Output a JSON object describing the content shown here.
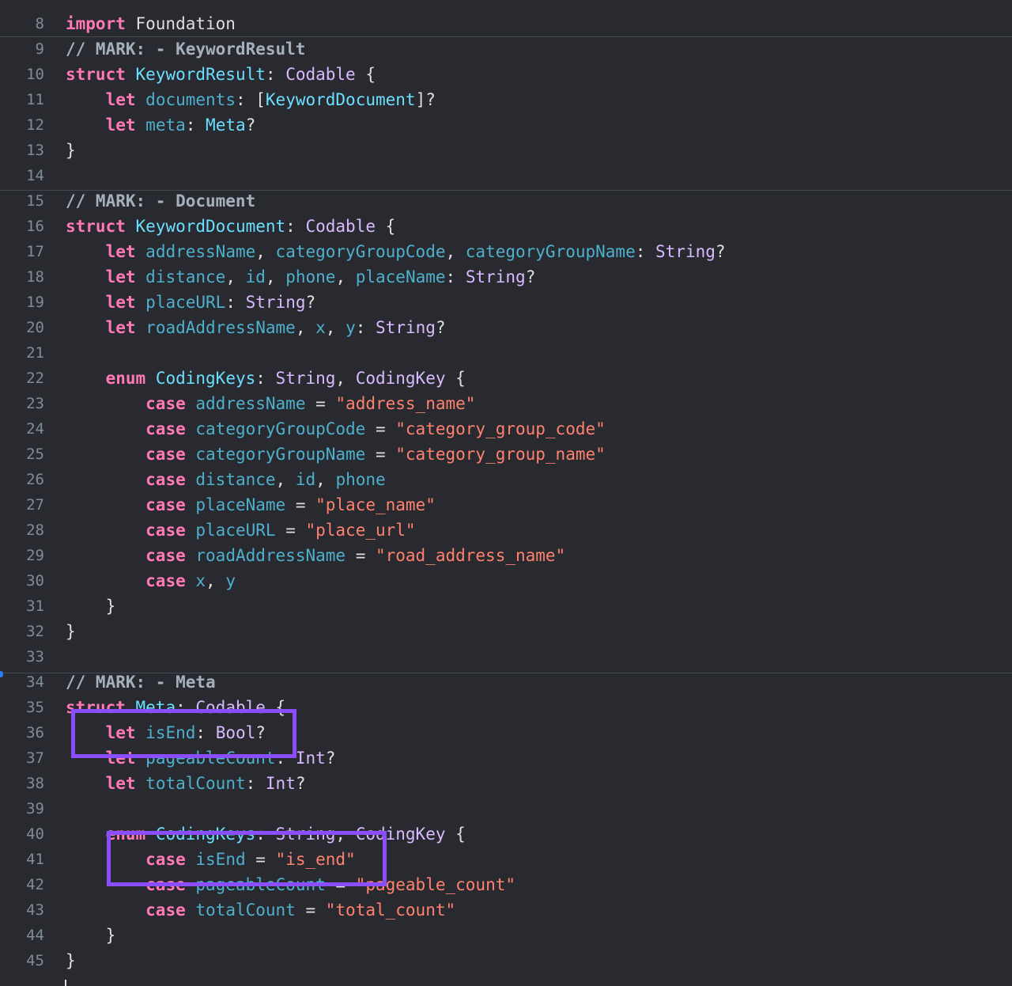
{
  "editor": {
    "language": "swift",
    "theme": "dark",
    "colors": {
      "background": "#292a30",
      "keyword": "#ff7ab2",
      "type": "#dabaff",
      "type_decl": "#6bdfff",
      "property": "#4eb0cc",
      "string": "#ff8170",
      "comment": "#a4b0bc",
      "plain": "#dfdfe0",
      "line_number": "#7f8c98",
      "highlight_box": "#8a4dff"
    },
    "lines": [
      {
        "num": "8",
        "tokens": [
          {
            "t": "import",
            "k": "kw"
          },
          {
            "t": " Foundation",
            "k": "pl"
          }
        ]
      },
      {
        "num": "9",
        "tokens": [
          {
            "t": "// MARK: - KeywordResult",
            "k": "cm"
          }
        ]
      },
      {
        "num": "10",
        "tokens": [
          {
            "t": "struct",
            "k": "kw"
          },
          {
            "t": " ",
            "k": "pl"
          },
          {
            "t": "KeywordResult",
            "k": "td"
          },
          {
            "t": ": ",
            "k": "pl"
          },
          {
            "t": "Codable",
            "k": "ty"
          },
          {
            "t": " {",
            "k": "pl"
          }
        ]
      },
      {
        "num": "11",
        "tokens": [
          {
            "t": "    ",
            "k": "pl"
          },
          {
            "t": "let",
            "k": "kw"
          },
          {
            "t": " ",
            "k": "pl"
          },
          {
            "t": "documents",
            "k": "pd"
          },
          {
            "t": ": [",
            "k": "pl"
          },
          {
            "t": "KeywordDocument",
            "k": "td"
          },
          {
            "t": "]?",
            "k": "pl"
          }
        ]
      },
      {
        "num": "12",
        "tokens": [
          {
            "t": "    ",
            "k": "pl"
          },
          {
            "t": "let",
            "k": "kw"
          },
          {
            "t": " ",
            "k": "pl"
          },
          {
            "t": "meta",
            "k": "pd"
          },
          {
            "t": ": ",
            "k": "pl"
          },
          {
            "t": "Meta",
            "k": "td"
          },
          {
            "t": "?",
            "k": "pl"
          }
        ]
      },
      {
        "num": "13",
        "tokens": [
          {
            "t": "}",
            "k": "pl"
          }
        ]
      },
      {
        "num": "14",
        "tokens": []
      },
      {
        "num": "15",
        "tokens": [
          {
            "t": "// MARK: - Document",
            "k": "cm"
          }
        ]
      },
      {
        "num": "16",
        "tokens": [
          {
            "t": "struct",
            "k": "kw"
          },
          {
            "t": " ",
            "k": "pl"
          },
          {
            "t": "KeywordDocument",
            "k": "td"
          },
          {
            "t": ": ",
            "k": "pl"
          },
          {
            "t": "Codable",
            "k": "ty"
          },
          {
            "t": " {",
            "k": "pl"
          }
        ]
      },
      {
        "num": "17",
        "tokens": [
          {
            "t": "    ",
            "k": "pl"
          },
          {
            "t": "let",
            "k": "kw"
          },
          {
            "t": " ",
            "k": "pl"
          },
          {
            "t": "addressName",
            "k": "pd"
          },
          {
            "t": ", ",
            "k": "pl"
          },
          {
            "t": "categoryGroupCode",
            "k": "pd"
          },
          {
            "t": ", ",
            "k": "pl"
          },
          {
            "t": "categoryGroupName",
            "k": "pd"
          },
          {
            "t": ": ",
            "k": "pl"
          },
          {
            "t": "String",
            "k": "ty"
          },
          {
            "t": "?",
            "k": "pl"
          }
        ]
      },
      {
        "num": "18",
        "tokens": [
          {
            "t": "    ",
            "k": "pl"
          },
          {
            "t": "let",
            "k": "kw"
          },
          {
            "t": " ",
            "k": "pl"
          },
          {
            "t": "distance",
            "k": "pd"
          },
          {
            "t": ", ",
            "k": "pl"
          },
          {
            "t": "id",
            "k": "pd"
          },
          {
            "t": ", ",
            "k": "pl"
          },
          {
            "t": "phone",
            "k": "pd"
          },
          {
            "t": ", ",
            "k": "pl"
          },
          {
            "t": "placeName",
            "k": "pd"
          },
          {
            "t": ": ",
            "k": "pl"
          },
          {
            "t": "String",
            "k": "ty"
          },
          {
            "t": "?",
            "k": "pl"
          }
        ]
      },
      {
        "num": "19",
        "tokens": [
          {
            "t": "    ",
            "k": "pl"
          },
          {
            "t": "let",
            "k": "kw"
          },
          {
            "t": " ",
            "k": "pl"
          },
          {
            "t": "placeURL",
            "k": "pd"
          },
          {
            "t": ": ",
            "k": "pl"
          },
          {
            "t": "String",
            "k": "ty"
          },
          {
            "t": "?",
            "k": "pl"
          }
        ]
      },
      {
        "num": "20",
        "tokens": [
          {
            "t": "    ",
            "k": "pl"
          },
          {
            "t": "let",
            "k": "kw"
          },
          {
            "t": " ",
            "k": "pl"
          },
          {
            "t": "roadAddressName",
            "k": "pd"
          },
          {
            "t": ", ",
            "k": "pl"
          },
          {
            "t": "x",
            "k": "pd"
          },
          {
            "t": ", ",
            "k": "pl"
          },
          {
            "t": "y",
            "k": "pd"
          },
          {
            "t": ": ",
            "k": "pl"
          },
          {
            "t": "String",
            "k": "ty"
          },
          {
            "t": "?",
            "k": "pl"
          }
        ]
      },
      {
        "num": "21",
        "tokens": []
      },
      {
        "num": "22",
        "tokens": [
          {
            "t": "    ",
            "k": "pl"
          },
          {
            "t": "enum",
            "k": "kw"
          },
          {
            "t": " ",
            "k": "pl"
          },
          {
            "t": "CodingKeys",
            "k": "td"
          },
          {
            "t": ": ",
            "k": "pl"
          },
          {
            "t": "String",
            "k": "ty"
          },
          {
            "t": ", ",
            "k": "pl"
          },
          {
            "t": "CodingKey",
            "k": "ty"
          },
          {
            "t": " {",
            "k": "pl"
          }
        ]
      },
      {
        "num": "23",
        "tokens": [
          {
            "t": "        ",
            "k": "pl"
          },
          {
            "t": "case",
            "k": "kw"
          },
          {
            "t": " ",
            "k": "pl"
          },
          {
            "t": "addressName",
            "k": "pd"
          },
          {
            "t": " = ",
            "k": "pl"
          },
          {
            "t": "\"address_name\"",
            "k": "str"
          }
        ]
      },
      {
        "num": "24",
        "tokens": [
          {
            "t": "        ",
            "k": "pl"
          },
          {
            "t": "case",
            "k": "kw"
          },
          {
            "t": " ",
            "k": "pl"
          },
          {
            "t": "categoryGroupCode",
            "k": "pd"
          },
          {
            "t": " = ",
            "k": "pl"
          },
          {
            "t": "\"category_group_code\"",
            "k": "str"
          }
        ]
      },
      {
        "num": "25",
        "tokens": [
          {
            "t": "        ",
            "k": "pl"
          },
          {
            "t": "case",
            "k": "kw"
          },
          {
            "t": " ",
            "k": "pl"
          },
          {
            "t": "categoryGroupName",
            "k": "pd"
          },
          {
            "t": " = ",
            "k": "pl"
          },
          {
            "t": "\"category_group_name\"",
            "k": "str"
          }
        ]
      },
      {
        "num": "26",
        "tokens": [
          {
            "t": "        ",
            "k": "pl"
          },
          {
            "t": "case",
            "k": "kw"
          },
          {
            "t": " ",
            "k": "pl"
          },
          {
            "t": "distance",
            "k": "pd"
          },
          {
            "t": ", ",
            "k": "pl"
          },
          {
            "t": "id",
            "k": "pd"
          },
          {
            "t": ", ",
            "k": "pl"
          },
          {
            "t": "phone",
            "k": "pd"
          }
        ]
      },
      {
        "num": "27",
        "tokens": [
          {
            "t": "        ",
            "k": "pl"
          },
          {
            "t": "case",
            "k": "kw"
          },
          {
            "t": " ",
            "k": "pl"
          },
          {
            "t": "placeName",
            "k": "pd"
          },
          {
            "t": " = ",
            "k": "pl"
          },
          {
            "t": "\"place_name\"",
            "k": "str"
          }
        ]
      },
      {
        "num": "28",
        "tokens": [
          {
            "t": "        ",
            "k": "pl"
          },
          {
            "t": "case",
            "k": "kw"
          },
          {
            "t": " ",
            "k": "pl"
          },
          {
            "t": "placeURL",
            "k": "pd"
          },
          {
            "t": " = ",
            "k": "pl"
          },
          {
            "t": "\"place_url\"",
            "k": "str"
          }
        ]
      },
      {
        "num": "29",
        "tokens": [
          {
            "t": "        ",
            "k": "pl"
          },
          {
            "t": "case",
            "k": "kw"
          },
          {
            "t": " ",
            "k": "pl"
          },
          {
            "t": "roadAddressName",
            "k": "pd"
          },
          {
            "t": " = ",
            "k": "pl"
          },
          {
            "t": "\"road_address_name\"",
            "k": "str"
          }
        ]
      },
      {
        "num": "30",
        "tokens": [
          {
            "t": "        ",
            "k": "pl"
          },
          {
            "t": "case",
            "k": "kw"
          },
          {
            "t": " ",
            "k": "pl"
          },
          {
            "t": "x",
            "k": "pd"
          },
          {
            "t": ", ",
            "k": "pl"
          },
          {
            "t": "y",
            "k": "pd"
          }
        ]
      },
      {
        "num": "31",
        "tokens": [
          {
            "t": "    }",
            "k": "pl"
          }
        ]
      },
      {
        "num": "32",
        "tokens": [
          {
            "t": "}",
            "k": "pl"
          }
        ]
      },
      {
        "num": "33",
        "tokens": []
      },
      {
        "num": "34",
        "tokens": [
          {
            "t": "// MARK: - Meta",
            "k": "cm"
          }
        ]
      },
      {
        "num": "35",
        "tokens": [
          {
            "t": "struct",
            "k": "kw"
          },
          {
            "t": " ",
            "k": "pl"
          },
          {
            "t": "Meta",
            "k": "td"
          },
          {
            "t": ": ",
            "k": "pl"
          },
          {
            "t": "Codable",
            "k": "ty"
          },
          {
            "t": " {",
            "k": "pl"
          }
        ]
      },
      {
        "num": "36",
        "tokens": [
          {
            "t": "    ",
            "k": "pl"
          },
          {
            "t": "let",
            "k": "kw"
          },
          {
            "t": " ",
            "k": "pl"
          },
          {
            "t": "isEnd",
            "k": "pd"
          },
          {
            "t": ": ",
            "k": "pl"
          },
          {
            "t": "Bool",
            "k": "ty"
          },
          {
            "t": "?",
            "k": "pl"
          }
        ]
      },
      {
        "num": "37",
        "tokens": [
          {
            "t": "    ",
            "k": "pl"
          },
          {
            "t": "let",
            "k": "kw"
          },
          {
            "t": " ",
            "k": "pl"
          },
          {
            "t": "pageableCount",
            "k": "pd"
          },
          {
            "t": ": ",
            "k": "pl"
          },
          {
            "t": "Int",
            "k": "ty"
          },
          {
            "t": "?",
            "k": "pl"
          }
        ]
      },
      {
        "num": "38",
        "tokens": [
          {
            "t": "    ",
            "k": "pl"
          },
          {
            "t": "let",
            "k": "kw"
          },
          {
            "t": " ",
            "k": "pl"
          },
          {
            "t": "totalCount",
            "k": "pd"
          },
          {
            "t": ": ",
            "k": "pl"
          },
          {
            "t": "Int",
            "k": "ty"
          },
          {
            "t": "?",
            "k": "pl"
          }
        ]
      },
      {
        "num": "39",
        "tokens": []
      },
      {
        "num": "40",
        "tokens": [
          {
            "t": "    ",
            "k": "pl"
          },
          {
            "t": "enum",
            "k": "kw"
          },
          {
            "t": " ",
            "k": "pl"
          },
          {
            "t": "CodingKeys",
            "k": "td"
          },
          {
            "t": ": ",
            "k": "pl"
          },
          {
            "t": "String",
            "k": "ty"
          },
          {
            "t": ", ",
            "k": "pl"
          },
          {
            "t": "CodingKey",
            "k": "ty"
          },
          {
            "t": " {",
            "k": "pl"
          }
        ]
      },
      {
        "num": "41",
        "tokens": [
          {
            "t": "        ",
            "k": "pl"
          },
          {
            "t": "case",
            "k": "kw"
          },
          {
            "t": " ",
            "k": "pl"
          },
          {
            "t": "isEnd",
            "k": "pd"
          },
          {
            "t": " = ",
            "k": "pl"
          },
          {
            "t": "\"is_end\"",
            "k": "str"
          }
        ]
      },
      {
        "num": "42",
        "tokens": [
          {
            "t": "        ",
            "k": "pl"
          },
          {
            "t": "case",
            "k": "kw"
          },
          {
            "t": " ",
            "k": "pl"
          },
          {
            "t": "pageableCount",
            "k": "pd"
          },
          {
            "t": " = ",
            "k": "pl"
          },
          {
            "t": "\"pageable_count\"",
            "k": "str"
          }
        ]
      },
      {
        "num": "43",
        "tokens": [
          {
            "t": "        ",
            "k": "pl"
          },
          {
            "t": "case",
            "k": "kw"
          },
          {
            "t": " ",
            "k": "pl"
          },
          {
            "t": "totalCount",
            "k": "pd"
          },
          {
            "t": " = ",
            "k": "pl"
          },
          {
            "t": "\"total_count\"",
            "k": "str"
          }
        ]
      },
      {
        "num": "44",
        "tokens": [
          {
            "t": "    }",
            "k": "pl"
          }
        ]
      },
      {
        "num": "45",
        "tokens": [
          {
            "t": "}",
            "k": "pl"
          }
        ]
      }
    ]
  }
}
